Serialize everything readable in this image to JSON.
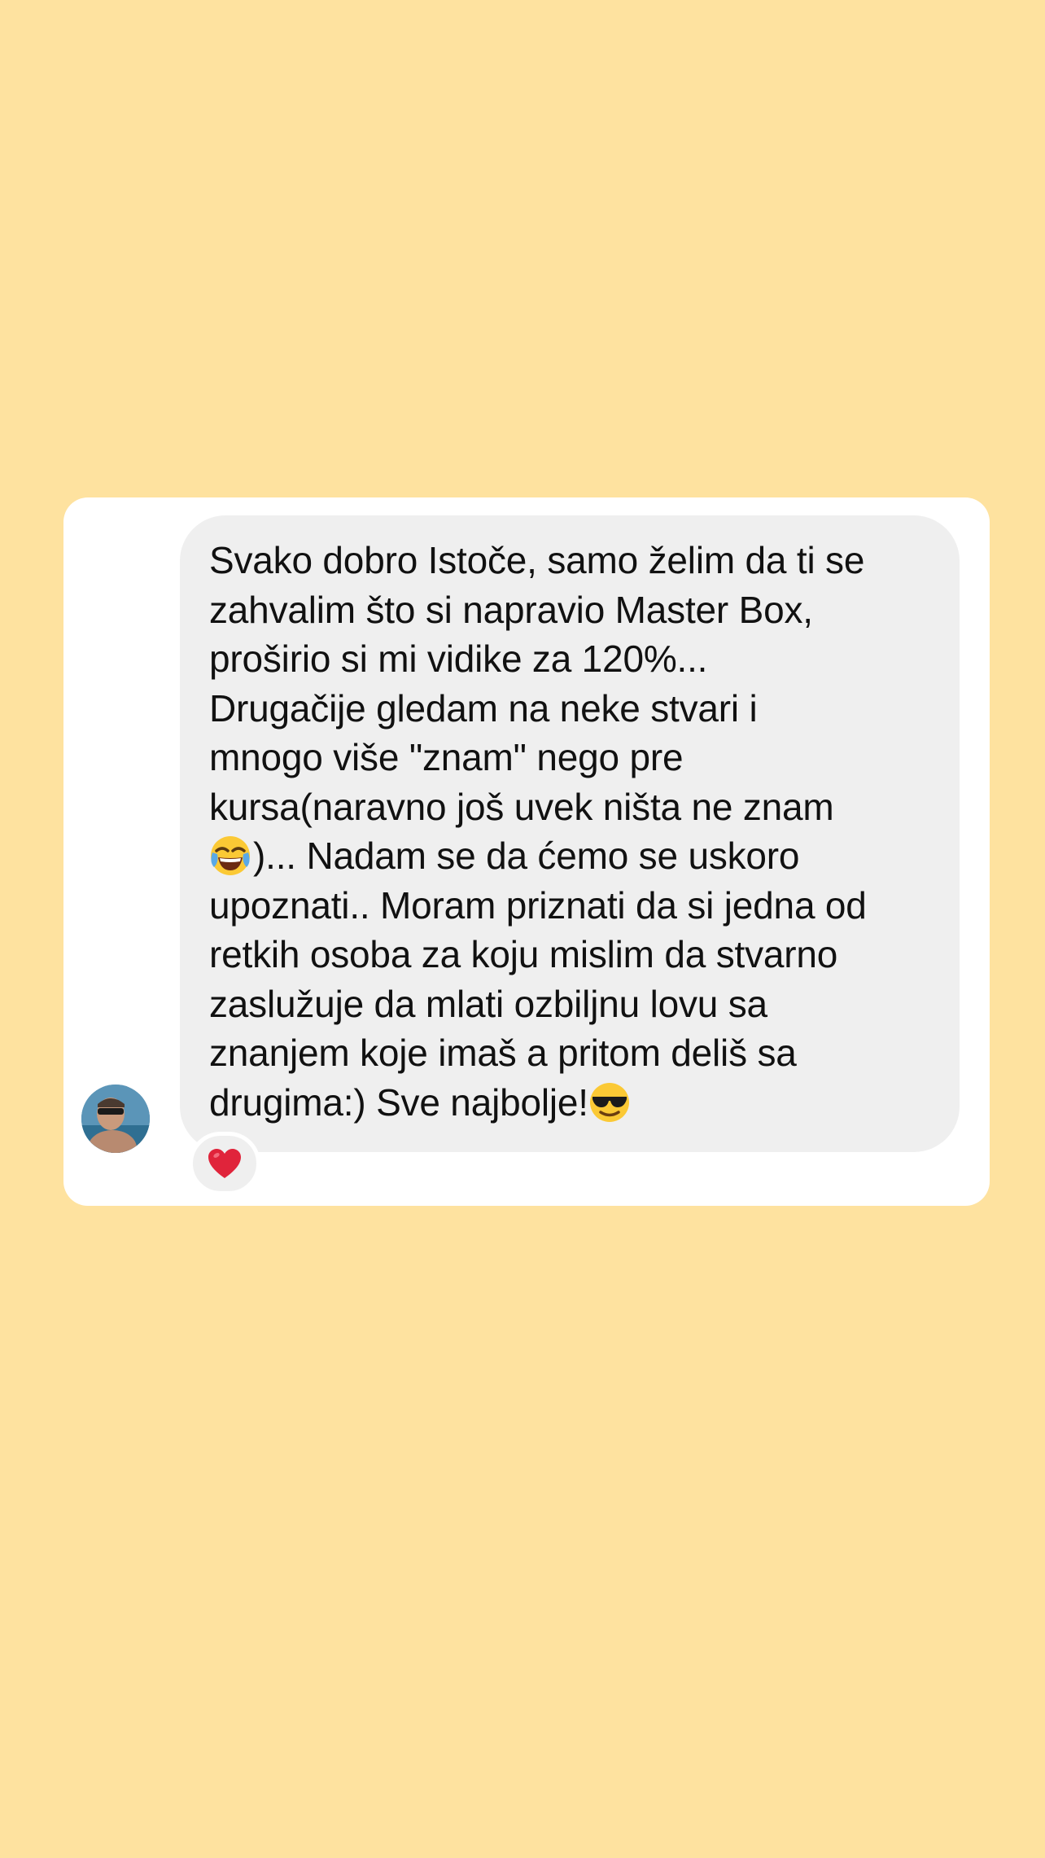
{
  "colors": {
    "background": "#fee29f",
    "card": "#ffffff",
    "bubble": "#efefef",
    "text": "#111111",
    "heart": "#e0243b"
  },
  "chat": {
    "avatar": {
      "icon": "profile-photo"
    },
    "message": {
      "lines": [
        "Svako dobro Istoče, samo želim da ti se",
        "zahvalim što si napravio Master Box,",
        "proširio si mi vidike za 120%...",
        "Drugačije gledam na neke stvari i",
        "mnogo više \"znam\" nego pre",
        "kursa(naravno još uvek ništa ne znam",
        ")... Nadam se da ćemo se uskoro",
        "upoznati.. Moram priznati da si jedna od",
        "retkih osoba za koju mislim da stvarno",
        "zaslužuje da mlati ozbiljnu lovu sa",
        "znanjem koje imaš a pritom deliš sa",
        "drugima:) Sve najbolje!"
      ],
      "emojis": {
        "line7_start": "face-with-tears-of-joy-emoji",
        "line12_end": "smiling-face-with-sunglasses-emoji"
      }
    },
    "reaction": {
      "icon": "red-heart-emoji"
    }
  }
}
